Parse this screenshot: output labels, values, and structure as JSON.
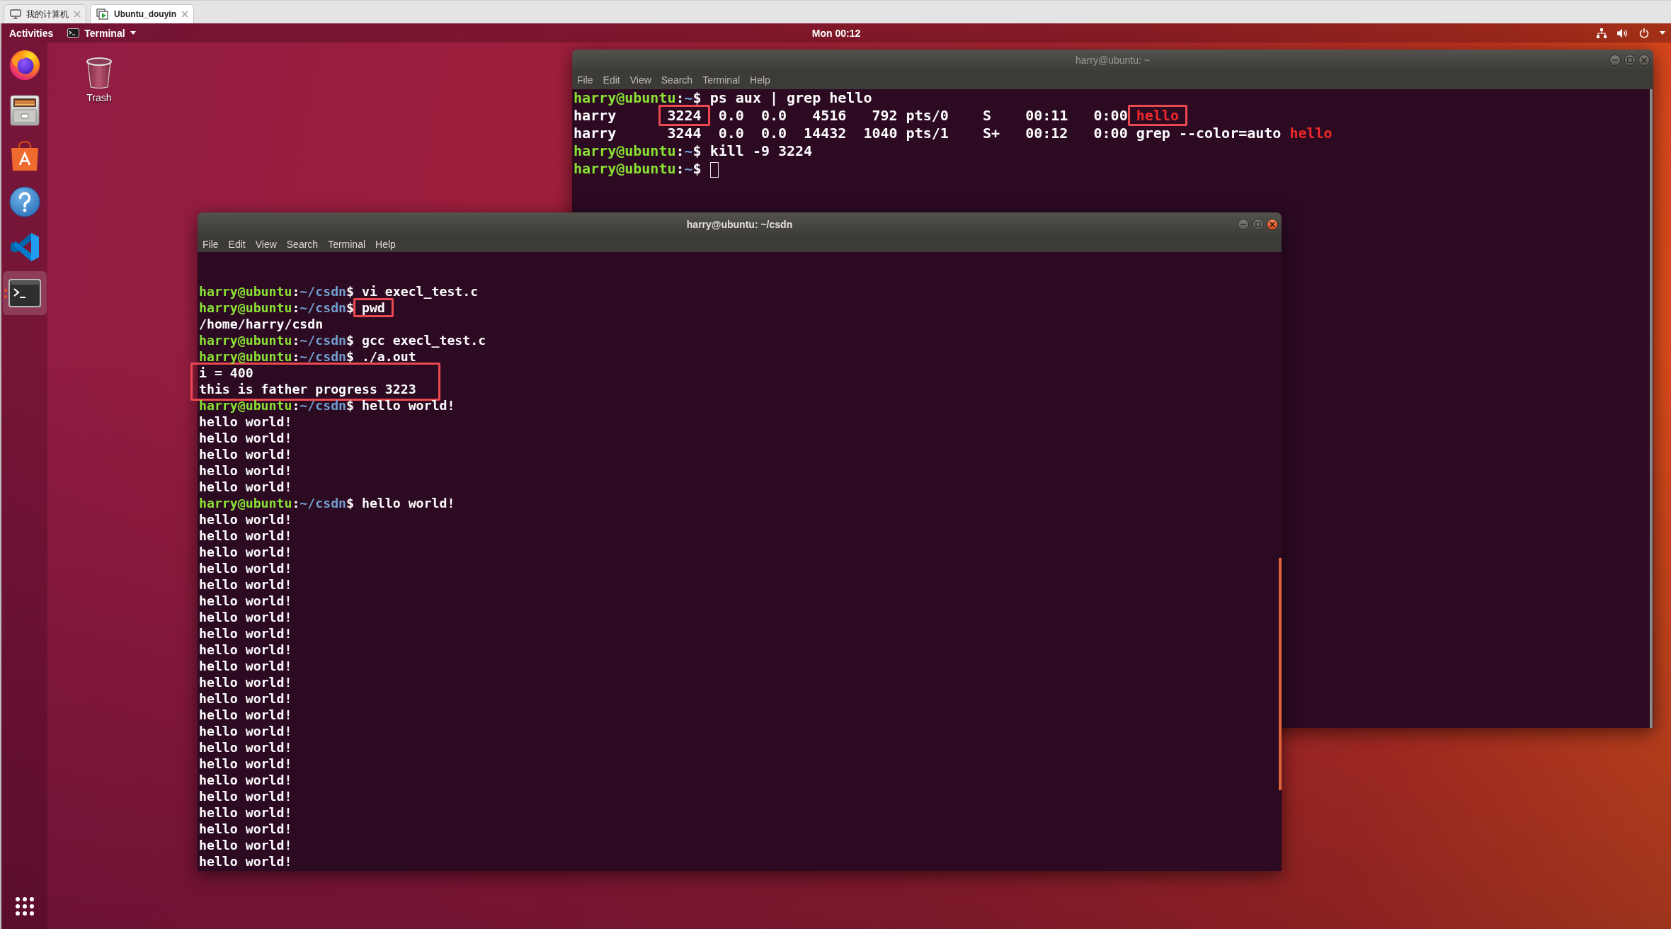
{
  "host_tabs": [
    {
      "label": "我的计算机",
      "kind": "computer",
      "selected": false
    },
    {
      "label": "Ubuntu_douyin",
      "kind": "vm",
      "selected": true
    }
  ],
  "top_bar": {
    "activities": "Activities",
    "app_menu": "Terminal",
    "clock": "Mon 00:12"
  },
  "dock": {
    "items": [
      {
        "kind": "browser",
        "running": false,
        "selected": false
      },
      {
        "kind": "files",
        "running": false,
        "selected": false
      },
      {
        "kind": "software",
        "running": false,
        "selected": false
      },
      {
        "kind": "help",
        "running": false,
        "selected": false
      },
      {
        "kind": "code",
        "running": false,
        "selected": false
      },
      {
        "kind": "terminal",
        "running": true,
        "selected": true
      }
    ]
  },
  "desktop": {
    "icons": [
      {
        "kind": "trash",
        "label": "Trash"
      }
    ]
  },
  "windows": [
    {
      "title": "harry@ubuntu: ~",
      "active": false,
      "menu": [
        "File",
        "Edit",
        "View",
        "Search",
        "Terminal",
        "Help"
      ],
      "lines": [
        {
          "kind": "prompt",
          "user": "harry@ubuntu",
          "separator": ":",
          "path": "~",
          "symbol": "$",
          "command": "ps aux | grep hello",
          "boxed": false,
          "cursor": false
        },
        {
          "kind": "segments",
          "segments": [
            {
              "text": "harry      ",
              "kind": "plain",
              "boxed": false
            },
            {
              "text": "3224",
              "kind": "plain",
              "boxed": true
            },
            {
              "text": "  0.0  0.0   4516   792 pts/0    S    00:11   0:00 ",
              "kind": "plain",
              "boxed": false
            },
            {
              "text": "hello",
              "kind": "match",
              "boxed": true
            }
          ]
        },
        {
          "kind": "segments",
          "segments": [
            {
              "text": "harry      3244  0.0  0.0  14432  1040 pts/1    S+   00:12   0:00 grep --color=auto ",
              "kind": "plain",
              "boxed": false
            },
            {
              "text": "hello",
              "kind": "match",
              "boxed": false
            }
          ]
        },
        {
          "kind": "prompt",
          "user": "harry@ubuntu",
          "separator": ":",
          "path": "~",
          "symbol": "$",
          "command": "kill -9 3224",
          "boxed": false,
          "cursor": false
        },
        {
          "kind": "prompt",
          "user": "harry@ubuntu",
          "separator": ":",
          "path": "~",
          "symbol": "$",
          "boxed": false,
          "cursor": true
        }
      ]
    },
    {
      "title": "harry@ubuntu: ~/csdn",
      "active": true,
      "menu": [
        "File",
        "Edit",
        "View",
        "Search",
        "Terminal",
        "Help"
      ],
      "lines": [
        {
          "kind": "prompt",
          "user": "harry@ubuntu",
          "separator": ":",
          "path": "~/csdn",
          "symbol": "$",
          "command": "vi execl_test.c",
          "boxed": false,
          "cursor": false
        },
        {
          "kind": "prompt",
          "user": "harry@ubuntu",
          "separator": ":",
          "path": "~/csdn",
          "symbol": "$",
          "command": "pwd",
          "boxed": true,
          "cursor": false
        },
        {
          "kind": "output",
          "text": "/home/harry/csdn"
        },
        {
          "kind": "prompt",
          "user": "harry@ubuntu",
          "separator": ":",
          "path": "~/csdn",
          "symbol": "$",
          "command": "gcc execl_test.c",
          "boxed": false,
          "cursor": false
        },
        {
          "kind": "prompt",
          "user": "harry@ubuntu",
          "separator": ":",
          "path": "~/csdn",
          "symbol": "$",
          "command": "./a.out",
          "boxed": false,
          "cursor": false
        },
        {
          "kind": "boxed_group",
          "lines": [
            "i = 400",
            "this is father progress 3223"
          ]
        },
        {
          "kind": "prompt",
          "user": "harry@ubuntu",
          "separator": ":",
          "path": "~/csdn",
          "symbol": "$",
          "command": "hello world!",
          "boxed": false,
          "cursor": false
        },
        {
          "kind": "output",
          "text": "hello world!"
        },
        {
          "kind": "output",
          "text": "hello world!"
        },
        {
          "kind": "output",
          "text": "hello world!"
        },
        {
          "kind": "output",
          "text": "hello world!"
        },
        {
          "kind": "output",
          "text": "hello world!"
        },
        {
          "kind": "prompt",
          "user": "harry@ubuntu",
          "separator": ":",
          "path": "~/csdn",
          "symbol": "$",
          "command": "hello world!",
          "boxed": false,
          "cursor": false
        },
        {
          "kind": "output",
          "text": "hello world!"
        },
        {
          "kind": "output",
          "text": "hello world!"
        },
        {
          "kind": "output",
          "text": "hello world!"
        },
        {
          "kind": "output",
          "text": "hello world!"
        },
        {
          "kind": "output",
          "text": "hello world!"
        },
        {
          "kind": "output",
          "text": "hello world!"
        },
        {
          "kind": "output",
          "text": "hello world!"
        },
        {
          "kind": "output",
          "text": "hello world!"
        },
        {
          "kind": "output",
          "text": "hello world!"
        },
        {
          "kind": "output",
          "text": "hello world!"
        },
        {
          "kind": "output",
          "text": "hello world!"
        },
        {
          "kind": "output",
          "text": "hello world!"
        },
        {
          "kind": "output",
          "text": "hello world!"
        },
        {
          "kind": "output",
          "text": "hello world!"
        },
        {
          "kind": "output",
          "text": "hello world!"
        },
        {
          "kind": "output",
          "text": "hello world!"
        },
        {
          "kind": "output",
          "text": "hello world!"
        },
        {
          "kind": "output",
          "text": "hello world!"
        },
        {
          "kind": "output",
          "text": "hello world!"
        },
        {
          "kind": "output",
          "text": "hello world!"
        },
        {
          "kind": "output",
          "text": "hello world!"
        },
        {
          "kind": "output",
          "text": "hello world!"
        }
      ]
    }
  ]
}
